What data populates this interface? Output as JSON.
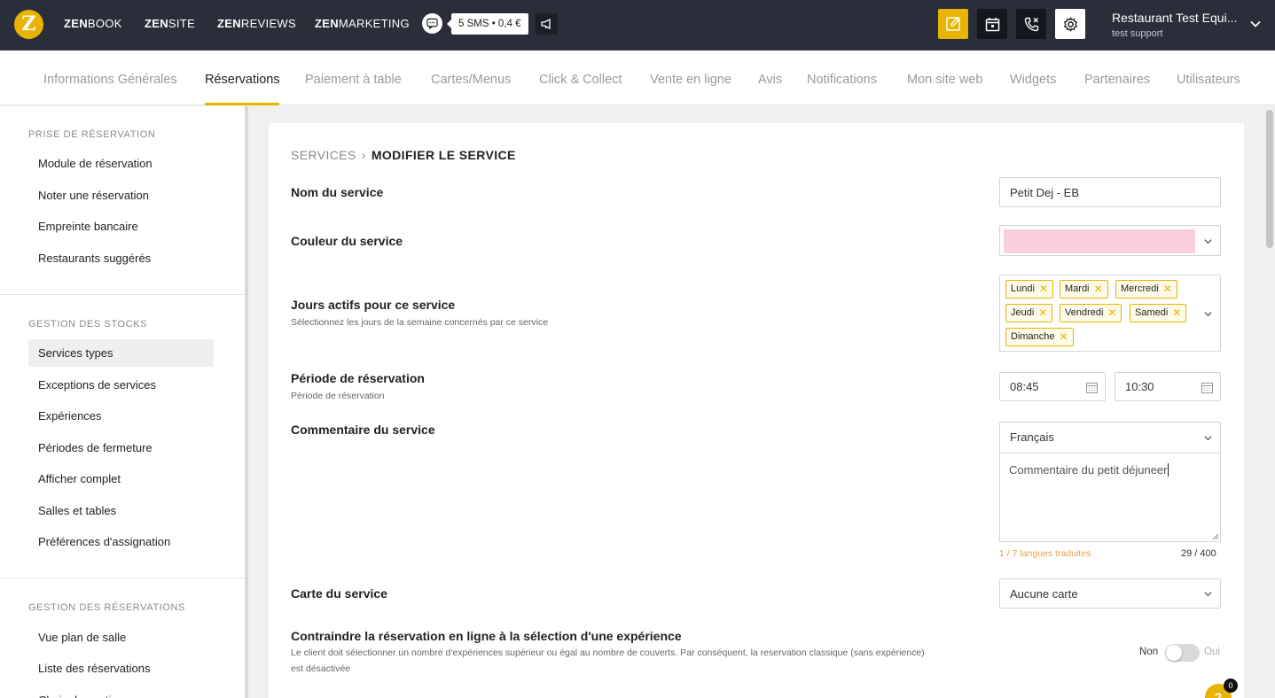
{
  "topbar": {
    "logo_letter": "Z",
    "nav": [
      {
        "bold": "ZEN",
        "rest": "BOOK"
      },
      {
        "bold": "ZEN",
        "rest": "SITE"
      },
      {
        "bold": "ZEN",
        "rest": "REVIEWS"
      },
      {
        "bold": "ZEN",
        "rest": "MARKETING"
      }
    ],
    "sms_tag": "5 SMS • 0,4 €",
    "account_name": "Restaurant Test Equi...",
    "account_sub": "test support",
    "accent_color": "#e8b400",
    "bar_color": "#2a2d3a"
  },
  "tabs": [
    "Informations Générales",
    "Réservations",
    "Paiement à table",
    "Cartes/Menus",
    "Click & Collect",
    "Vente en ligne",
    "Avis",
    "Notifications",
    "Mon site web",
    "Widgets",
    "Partenaires",
    "Utilisateurs"
  ],
  "active_tab": "Réservations",
  "sidebar": {
    "sections": [
      {
        "heading": "PRISE DE RÉSERVATION",
        "items": [
          "Module de réservation",
          "Noter une réservation",
          "Empreinte bancaire",
          "Restaurants suggérés"
        ]
      },
      {
        "heading": "GESTION DES STOCKS",
        "items": [
          "Services types",
          "Exceptions de services",
          "Expériences",
          "Périodes de fermeture",
          "Afficher complet",
          "Salles et tables",
          "Préférences d'assignation"
        ]
      },
      {
        "heading": "GESTION DES RÉSERVATIONS",
        "items": [
          "Vue plan de salle",
          "Liste des réservations",
          "Choix des options"
        ]
      }
    ],
    "active_item": "Services types"
  },
  "breadcrumb": {
    "parent": "SERVICES",
    "current": "MODIFIER LE SERVICE"
  },
  "form": {
    "name_label": "Nom du service",
    "name_value": "Petit Dej - EB",
    "color_label": "Couleur du service",
    "color_value": "#f9cfe0",
    "days_label": "Jours actifs pour ce service",
    "days_hint": "Sélectionnez les jours de la semaine concernés par ce service",
    "days": [
      "Lundi",
      "Mardi",
      "Mercredi",
      "Jeudi",
      "Vendredi",
      "Samedi",
      "Dimanche"
    ],
    "period_label": "Période de réservation",
    "period_hint": "Période de réservation",
    "period_start": "08:45",
    "period_end": "10:30",
    "comment_label": "Commentaire du service",
    "comment_language": "Français",
    "comment_value": "Commentaire du petit déjuneer",
    "translated": "1 / 7 langues traduites",
    "char_count": "29 / 400",
    "menu_label": "Carte du service",
    "menu_value": "Aucune carte",
    "constraint_label": "Contraindre la réservation en ligne à la sélection d'une expérience",
    "constraint_hint_1": "Le client doit sélectionner un nombre d'expériences supérieur ou égal au nombre de couverts. Par conséquent, la reservation classique (sans expérience)",
    "constraint_hint_2": "est désactivée",
    "toggle_off": "Non",
    "toggle_on": "Oui",
    "toggle_enabled": false
  },
  "help": {
    "badge": "?",
    "count": "0"
  }
}
